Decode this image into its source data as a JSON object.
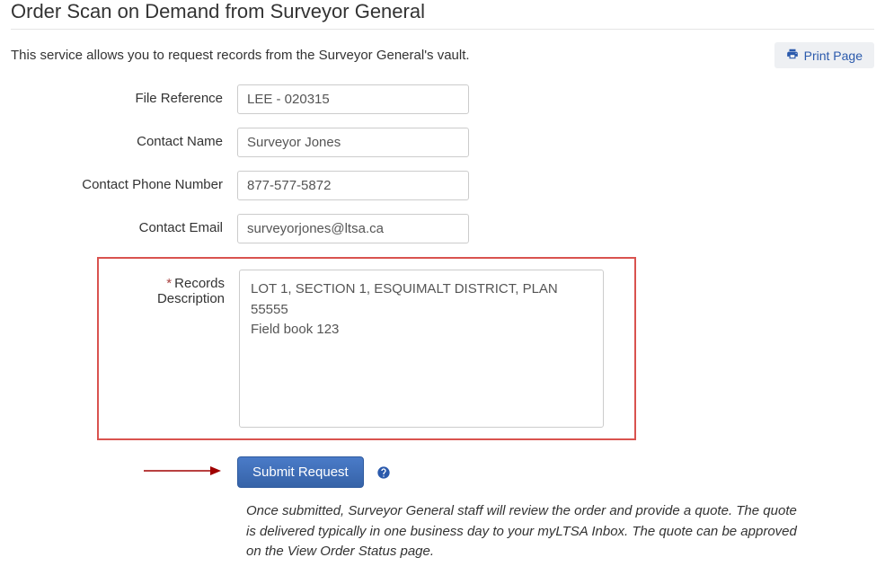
{
  "page": {
    "title": "Order Scan on Demand from Surveyor General",
    "intro": "This service allows you to request records from the Surveyor General's vault."
  },
  "actions": {
    "print_label": "Print Page",
    "submit_label": "Submit Request"
  },
  "form": {
    "file_reference": {
      "label": "File Reference",
      "value": "LEE - 020315"
    },
    "contact_name": {
      "label": "Contact Name",
      "value": "Surveyor Jones"
    },
    "contact_phone": {
      "label": "Contact Phone Number",
      "value": "877-577-5872"
    },
    "contact_email": {
      "label": "Contact Email",
      "value": "surveyorjones@ltsa.ca"
    },
    "records_description": {
      "label": "Records Description",
      "required_mark": "*",
      "value": "LOT 1, SECTION 1, ESQUIMALT DISTRICT, PLAN 55555\nField book 123"
    }
  },
  "help_text": "Once submitted, Surveyor General staff will review the order and provide a quote. The quote is delivered typically in one business day to your myLTSA Inbox. The quote can be approved on the View Order Status page."
}
